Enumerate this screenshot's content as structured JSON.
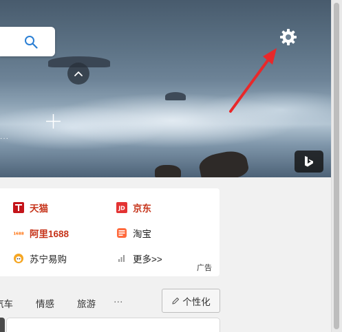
{
  "hero": {
    "search": {
      "placeholder": ""
    }
  },
  "quick_links": [
    {
      "label": "天猫",
      "icon": "tmall-icon",
      "style": "red"
    },
    {
      "label": "京东",
      "icon": "jd-icon",
      "style": "red"
    },
    {
      "label": "阿里1688",
      "icon": "alibaba-1688-icon",
      "style": "red"
    },
    {
      "label": "淘宝",
      "icon": "taobao-icon",
      "style": "dark"
    },
    {
      "label": "苏宁易购",
      "icon": "suning-icon",
      "style": "dark"
    },
    {
      "label": "更多>>",
      "icon": "more-icon",
      "style": "dark"
    }
  ],
  "ad_label": "广告",
  "nav": {
    "items": [
      "汽车",
      "情感",
      "旅游"
    ],
    "more": "···",
    "personalize": "个性化"
  },
  "bottom": {
    "text": ""
  },
  "colors": {
    "annotation_arrow": "#e8282a",
    "link_red": "#c6341a",
    "search_icon": "#2a7fd4"
  }
}
